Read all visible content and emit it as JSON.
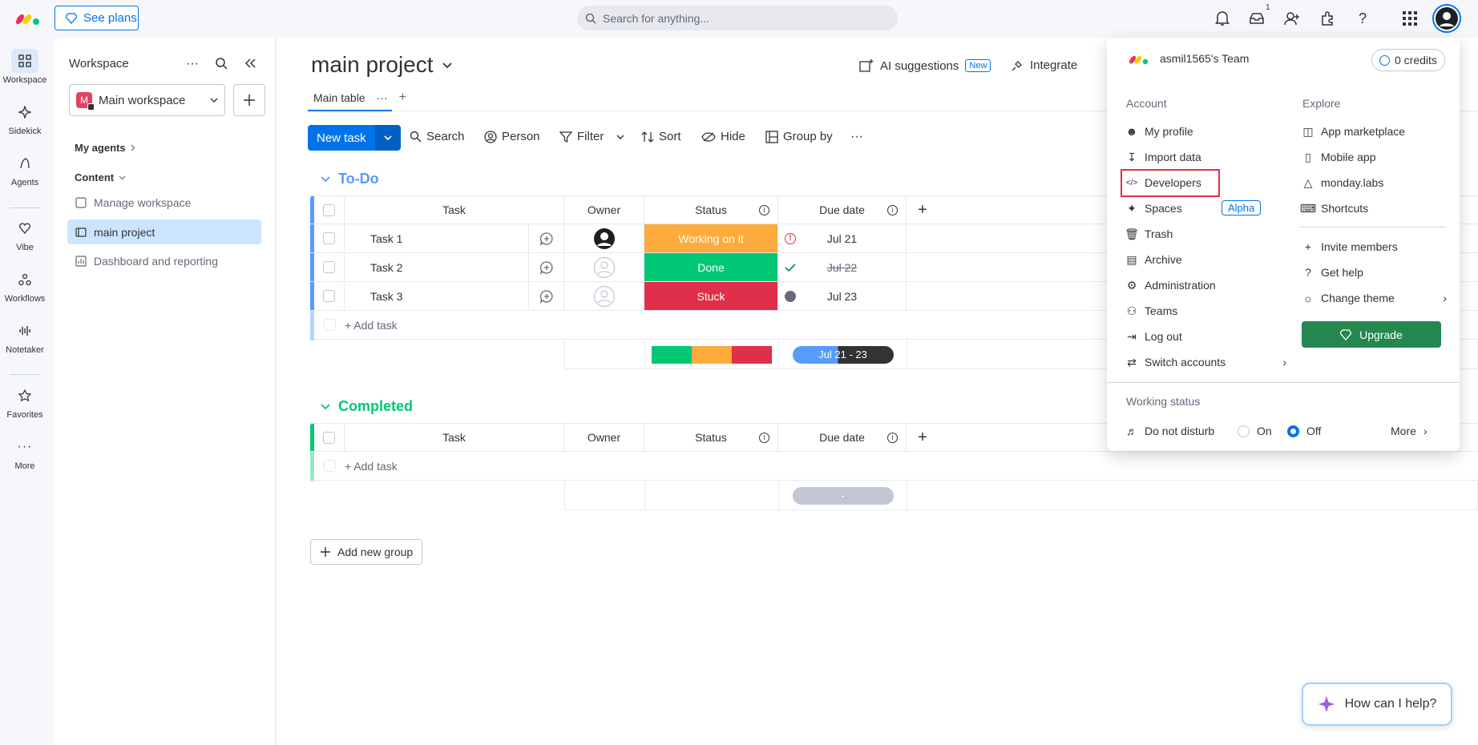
{
  "topbar": {
    "see_plans": "See plans",
    "search_placeholder": "Search for anything...",
    "inbox_count": "1"
  },
  "rail": {
    "items": [
      {
        "label": "Workspace",
        "icon": "grid-icon"
      },
      {
        "label": "Sidekick",
        "icon": "sparkle-icon"
      },
      {
        "label": "Agents",
        "icon": "agent-icon"
      },
      {
        "label": "Vibe",
        "icon": "heart-icon"
      },
      {
        "label": "Workflows",
        "icon": "workflow-icon"
      },
      {
        "label": "Notetaker",
        "icon": "waveform-icon"
      },
      {
        "label": "Favorites",
        "icon": "star-icon"
      },
      {
        "label": "More",
        "icon": "more-icon"
      }
    ]
  },
  "workspace": {
    "title": "Workspace",
    "selected": "Main workspace",
    "badge": "M",
    "my_agents": "My agents",
    "content": "Content",
    "nav": [
      "Manage workspace",
      "main project",
      "Dashboard and reporting"
    ]
  },
  "board": {
    "title": "main project",
    "ai_suggestions": "AI suggestions",
    "new_badge": "New",
    "integrate": "Integrate",
    "tab": "Main table",
    "new_task": "New task",
    "toolbar": [
      "Search",
      "Person",
      "Filter",
      "Sort",
      "Hide",
      "Group by"
    ]
  },
  "groups": {
    "todo": {
      "title": "To-Do",
      "color": "#579bfc",
      "columns": {
        "task": "Task",
        "owner": "Owner",
        "status": "Status",
        "due": "Due date"
      },
      "rows": [
        {
          "task": "Task 1",
          "status": "Working on it",
          "status_color": "#fdab3d",
          "due": "Jul 21"
        },
        {
          "task": "Task 2",
          "status": "Done",
          "status_color": "#00c875",
          "due": "Jul 22"
        },
        {
          "task": "Task 3",
          "status": "Stuck",
          "status_color": "#df2f4a",
          "due": "Jul 23"
        }
      ],
      "add_task": "+ Add task",
      "date_range": "Jul 21 - 23"
    },
    "completed": {
      "title": "Completed",
      "color": "#00c875",
      "columns": {
        "task": "Task",
        "owner": "Owner",
        "status": "Status",
        "due": "Due date"
      },
      "add_task": "+ Add task",
      "date_range": "-"
    },
    "add_new_group": "Add new group"
  },
  "dropdown": {
    "team": "asmil1565's Team",
    "credits": "0 credits",
    "account_head": "Account",
    "explore_head": "Explore",
    "account_items": [
      "My profile",
      "Import data",
      "Developers",
      "Spaces",
      "Trash",
      "Archive",
      "Administration",
      "Teams",
      "Log out",
      "Switch accounts"
    ],
    "alpha": "Alpha",
    "explore_items": [
      "App marketplace",
      "Mobile app",
      "monday.labs",
      "Shortcuts"
    ],
    "explore_items2": [
      "Invite members",
      "Get help",
      "Change theme"
    ],
    "upgrade": "Upgrade",
    "working_status": "Working status",
    "dnd": "Do not disturb",
    "on": "On",
    "off": "Off",
    "more": "More"
  },
  "help": "How can I help?"
}
